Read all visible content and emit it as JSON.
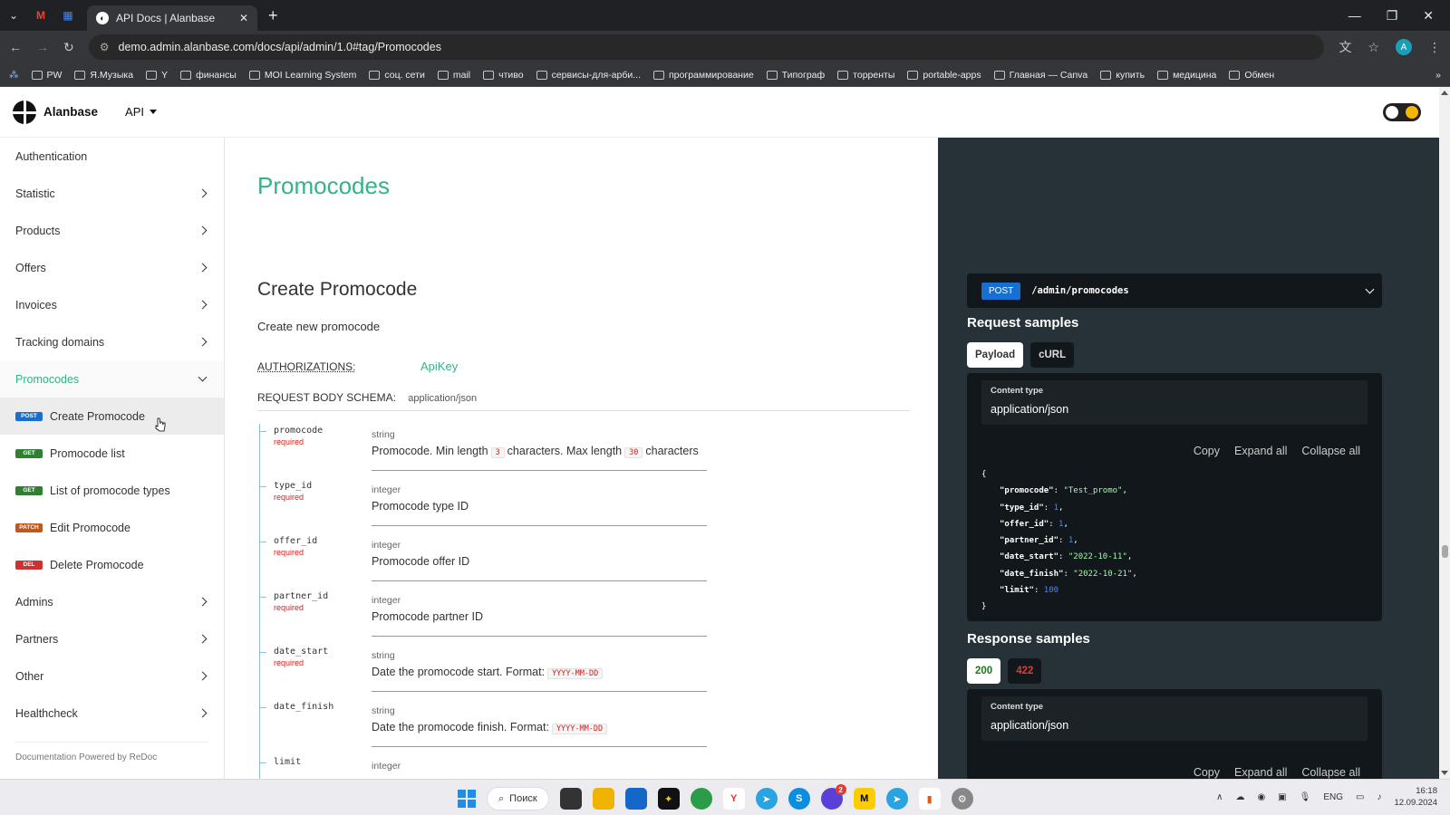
{
  "browser": {
    "tab_title": "API Docs | Alanbase",
    "url": "demo.admin.alanbase.com/docs/api/admin/1.0#tag/Promocodes",
    "profile_initial": "A",
    "bookmarks": [
      "PW",
      "Я.Музыка",
      "Y",
      "финансы",
      "MOI Learning System",
      "соц. сети",
      "mail",
      "чтиво",
      "сервисы-для-арби...",
      "программирование",
      "Типограф",
      "торренты",
      "portable-apps",
      "Главная — Canva",
      "купить",
      "медицина",
      "Обмен"
    ]
  },
  "header": {
    "logo_text": "Alanbase",
    "api_menu": "API"
  },
  "sidebar": {
    "items": [
      {
        "label": "Authentication",
        "chevron": false
      },
      {
        "label": "Statistic",
        "chevron": true
      },
      {
        "label": "Products",
        "chevron": true
      },
      {
        "label": "Offers",
        "chevron": true
      },
      {
        "label": "Invoices",
        "chevron": true
      },
      {
        "label": "Tracking domains",
        "chevron": true
      }
    ],
    "open_group": "Promocodes",
    "sub_items": [
      {
        "method": "POST",
        "label": "Create Promocode",
        "color": "#186fd2"
      },
      {
        "method": "GET",
        "label": "Promocode list",
        "color": "#2f8132"
      },
      {
        "method": "GET",
        "label": "List of promocode types",
        "color": "#2f8132"
      },
      {
        "method": "PATCH",
        "label": "Edit Promocode",
        "color": "#bf581d"
      },
      {
        "method": "DEL",
        "label": "Delete Promocode",
        "color": "#cc3333"
      }
    ],
    "items_after": [
      {
        "label": "Admins"
      },
      {
        "label": "Partners"
      },
      {
        "label": "Other"
      },
      {
        "label": "Healthcheck"
      }
    ],
    "footer": "Documentation Powered by ReDoc"
  },
  "main": {
    "section_title": "Promocodes",
    "operation_title": "Create Promocode",
    "description": "Create new promocode",
    "auth_label": "AUTHORIZATIONS:",
    "auth_value": "ApiKey",
    "schema_label": "REQUEST BODY SCHEMA:",
    "schema_mime": "application/json",
    "required_label": "required",
    "fields": [
      {
        "name": "promocode",
        "required": true,
        "type": "string",
        "desc_pre": "Promocode. Min length",
        "tok1": "3",
        "desc_mid": "characters. Max length",
        "tok2": "30",
        "desc_post": "characters"
      },
      {
        "name": "type_id",
        "required": true,
        "type": "integer",
        "desc_pre": "Promocode type ID"
      },
      {
        "name": "offer_id",
        "required": true,
        "type": "integer",
        "desc_pre": "Promocode offer ID"
      },
      {
        "name": "partner_id",
        "required": true,
        "type": "integer",
        "desc_pre": "Promocode partner ID"
      },
      {
        "name": "date_start",
        "required": true,
        "type": "string",
        "desc_pre": "Date the promocode start. Format:",
        "tok1": "YYYY-MM-DD"
      },
      {
        "name": "date_finish",
        "required": false,
        "type": "string",
        "desc_pre": "Date the promocode finish. Format:",
        "tok1": "YYYY-MM-DD"
      },
      {
        "name": "limit",
        "required": false,
        "type": "integer",
        "desc_pre": ""
      }
    ]
  },
  "right": {
    "method": "POST",
    "path": "/admin/promocodes",
    "request_title": "Request samples",
    "request_tabs": [
      "Payload",
      "cURL"
    ],
    "content_type_label": "Content type",
    "content_type_value": "application/json",
    "actions": [
      "Copy",
      "Expand all",
      "Collapse all"
    ],
    "payload": [
      {
        "key": "\"promocode\"",
        "value": "\"Test_promo\"",
        "kind": "s"
      },
      {
        "key": "\"type_id\"",
        "value": "1",
        "kind": "n"
      },
      {
        "key": "\"offer_id\"",
        "value": "1",
        "kind": "n"
      },
      {
        "key": "\"partner_id\"",
        "value": "1",
        "kind": "n"
      },
      {
        "key": "\"date_start\"",
        "value": "\"2022-10-11\"",
        "kind": "s"
      },
      {
        "key": "\"date_finish\"",
        "value": "\"2022-10-21\"",
        "kind": "s"
      },
      {
        "key": "\"limit\"",
        "value": "100",
        "kind": "n",
        "last": true
      }
    ],
    "response_title": "Response samples",
    "response_tabs": [
      "200",
      "422"
    ]
  },
  "taskbar": {
    "search": "Поиск",
    "lang": "ENG",
    "time": "16:18",
    "date": "12.09.2024",
    "notif_badge": "2"
  },
  "colors": {
    "accent": "#32b38a",
    "panel": "#263238",
    "panel_dark": "#11171a",
    "post": "#186fd2",
    "get": "#2f8132",
    "patch": "#bf581d",
    "delete": "#cc3333"
  }
}
